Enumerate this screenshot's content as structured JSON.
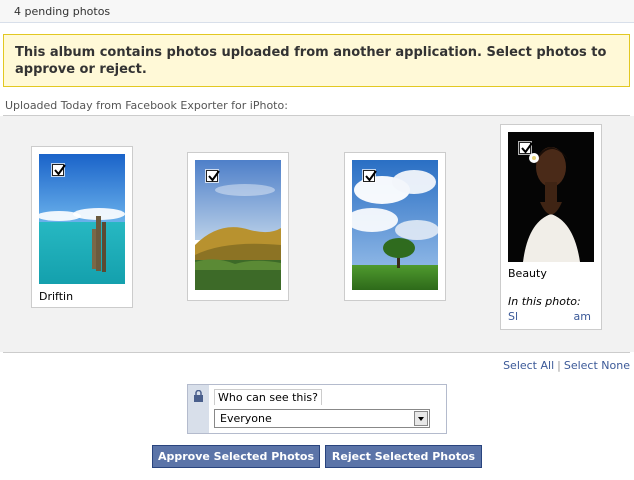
{
  "header": {
    "pending_text": "4 pending photos"
  },
  "notice": {
    "text": "This album contains photos uploaded from another application. Select photos to approve or reject."
  },
  "upload_source": {
    "text": "Uploaded Today from Facebook Exporter for iPhoto:"
  },
  "photos": [
    {
      "caption": "Driftin",
      "checked": true
    },
    {
      "caption": "",
      "checked": true
    },
    {
      "caption": "",
      "checked": true
    },
    {
      "caption": "Beauty",
      "checked": true,
      "in_photo_label": "In this photo:",
      "tag_start": "Sl",
      "tag_end": "am"
    }
  ],
  "selection": {
    "select_all": "Select All",
    "separator": "|",
    "select_none": "Select None"
  },
  "privacy": {
    "label": "Who can see this?",
    "value": "Everyone"
  },
  "buttons": {
    "approve": "Approve Selected Photos",
    "reject": "Reject Selected Photos"
  },
  "colors": {
    "link": "#3b5998",
    "button": "#5b74a8",
    "notice_bg": "#fff9d7",
    "notice_border": "#e2c822"
  }
}
